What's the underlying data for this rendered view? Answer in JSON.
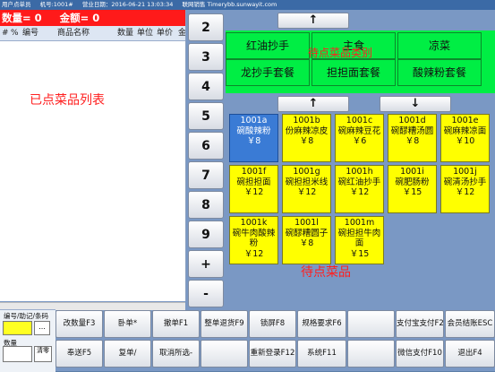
{
  "titlebar": {
    "app": "用户点单员",
    "machine": "机号:1001#",
    "date": "营业日期：2016-06-21 13:03:34",
    "net": "联网销售 Timerybb.sunwayit.com"
  },
  "summary": {
    "count_text": "数量= 0",
    "amount_text": "金额= 0"
  },
  "order_columns": [
    "#",
    "%",
    "编号",
    "商品名称",
    "数量",
    "单位",
    "单价",
    "金"
  ],
  "order_list_label": "已点菜品列表",
  "number_keys": [
    "2",
    "3",
    "4",
    "5",
    "6",
    "7",
    "8",
    "9",
    "+",
    "-"
  ],
  "arrows": {
    "up": "↑",
    "down": "↓"
  },
  "categories": {
    "label": "待点菜品类别",
    "items": [
      "红油抄手",
      "主食",
      "凉菜",
      "龙抄手套餐",
      "担担面套餐",
      "酸辣粉套餐"
    ]
  },
  "dishes": {
    "label": "待点菜品",
    "items": [
      {
        "code": "1001a",
        "name": "碗酸辣粉",
        "price": "￥8",
        "selected": true
      },
      {
        "code": "1001b",
        "name": "份麻辣凉皮",
        "price": "￥8",
        "selected": false
      },
      {
        "code": "1001c",
        "name": "碗麻辣豆花",
        "price": "￥6",
        "selected": false
      },
      {
        "code": "1001d",
        "name": "碗醪糟汤圆",
        "price": "￥8",
        "selected": false
      },
      {
        "code": "1001e",
        "name": "碗麻辣凉面",
        "price": "￥10",
        "selected": false
      },
      {
        "code": "1001f",
        "name": "碗担担面",
        "price": "￥12",
        "selected": false
      },
      {
        "code": "1001g",
        "name": "碗担担米线",
        "price": "￥12",
        "selected": false
      },
      {
        "code": "1001h",
        "name": "碗红油抄手",
        "price": "￥12",
        "selected": false
      },
      {
        "code": "1001i",
        "name": "碗肥肠粉",
        "price": "￥15",
        "selected": false
      },
      {
        "code": "1001j",
        "name": "碗清汤抄手",
        "price": "￥12",
        "selected": false
      },
      {
        "code": "1001k",
        "name": "碗牛肉酸辣粉",
        "price": "￥12",
        "selected": false
      },
      {
        "code": "1001l",
        "name": "碗醪糟圆子",
        "price": "￥8",
        "selected": false
      },
      {
        "code": "1001m",
        "name": "碗担担牛肉面",
        "price": "￥15",
        "selected": false
      }
    ]
  },
  "input": {
    "code_label": "编号/助记/条码",
    "dots": "...",
    "qty_label": "数量",
    "clear_label": "清零"
  },
  "functions": {
    "row1": [
      "改数量F3",
      "卧单*",
      "撤单F1",
      "整单退货F9",
      "锁屏F8",
      "规格要求F6",
      "",
      "支付宝支付F2",
      "会员结账ESC"
    ],
    "row2": [
      "奉送F5",
      "复单/",
      "取消所选-",
      "",
      "重新登录F12",
      "系统F11",
      "",
      "微信支付F10",
      "退出F4"
    ]
  }
}
